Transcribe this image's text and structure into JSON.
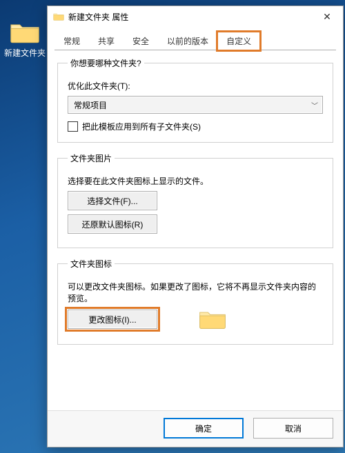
{
  "desktop": {
    "folder_label": "新建文件夹"
  },
  "dialog": {
    "title": "新建文件夹 属性",
    "tabs": [
      "常规",
      "共享",
      "安全",
      "以前的版本",
      "自定义"
    ],
    "active_tab_index": 4,
    "close_glyph": "✕"
  },
  "group_type": {
    "legend": "你想要哪种文件夹?",
    "optimize_label": "优化此文件夹(T):",
    "dropdown_value": "常规项目",
    "apply_subfolders_label": "把此模板应用到所有子文件夹(S)",
    "apply_subfolders_checked": false
  },
  "group_picture": {
    "legend": "文件夹图片",
    "description": "选择要在此文件夹图标上显示的文件。",
    "choose_file_btn": "选择文件(F)...",
    "restore_default_btn": "还原默认图标(R)"
  },
  "group_icon": {
    "legend": "文件夹图标",
    "description": "可以更改文件夹图标。如果更改了图标，它将不再显示文件夹内容的预览。",
    "change_icon_btn": "更改图标(I)..."
  },
  "footer": {
    "ok": "确定",
    "cancel": "取消"
  }
}
